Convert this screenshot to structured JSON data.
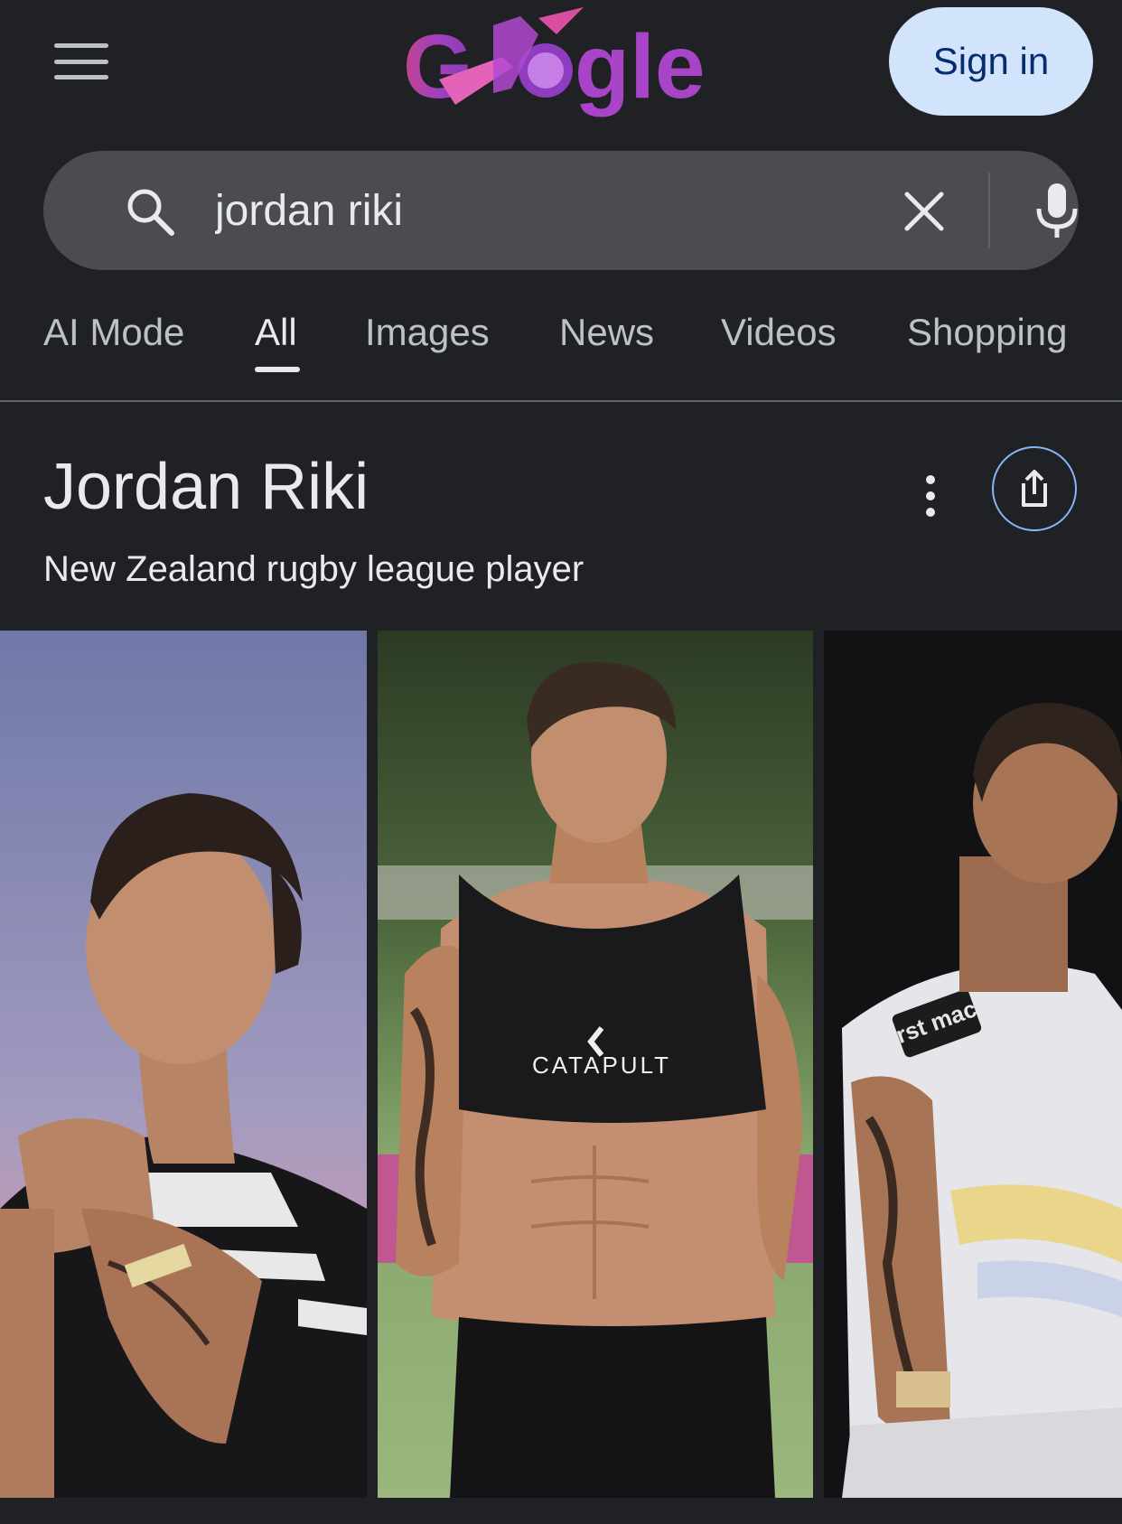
{
  "header": {
    "logo_alt": "Google",
    "signin_label": "Sign in"
  },
  "search": {
    "query": "jordan riki"
  },
  "tabs": [
    {
      "label": "AI Mode",
      "active": false
    },
    {
      "label": "All",
      "active": true
    },
    {
      "label": "Images",
      "active": false
    },
    {
      "label": "News",
      "active": false
    },
    {
      "label": "Videos",
      "active": false
    },
    {
      "label": "Shopping",
      "active": false
    }
  ],
  "knowledge_panel": {
    "title": "Jordan Riki",
    "subtitle": "New Zealand rugby league player"
  },
  "images": [
    {
      "caption": ""
    },
    {
      "caption": "CATAPULT"
    },
    {
      "caption": ""
    }
  ],
  "colors": {
    "background": "#202124",
    "search_bg": "#4a4c50",
    "signin_bg": "#d2e3fc",
    "accent_border": "#8ab4f8"
  }
}
